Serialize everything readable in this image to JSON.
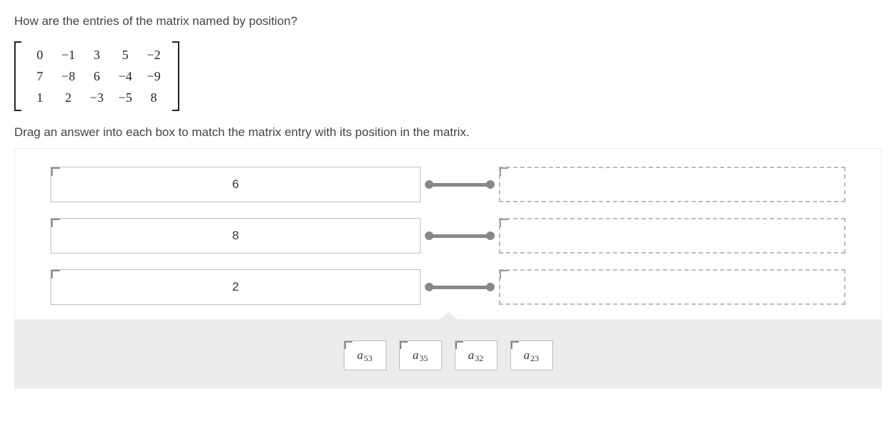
{
  "question": "How are the entries of the matrix named by position?",
  "matrix": {
    "rows": [
      [
        "0",
        "−1",
        "3",
        "5",
        "−2"
      ],
      [
        "7",
        "−8",
        "6",
        "−4",
        "−9"
      ],
      [
        "1",
        "2",
        "−3",
        "−5",
        "8"
      ]
    ]
  },
  "instruction": "Drag an answer into each box to match the matrix entry with its position in the matrix.",
  "match_rows": [
    {
      "value": "6"
    },
    {
      "value": "8"
    },
    {
      "value": "2"
    }
  ],
  "choices": [
    {
      "base": "a",
      "sub": "53"
    },
    {
      "base": "a",
      "sub": "35"
    },
    {
      "base": "a",
      "sub": "32"
    },
    {
      "base": "a",
      "sub": "23"
    }
  ]
}
